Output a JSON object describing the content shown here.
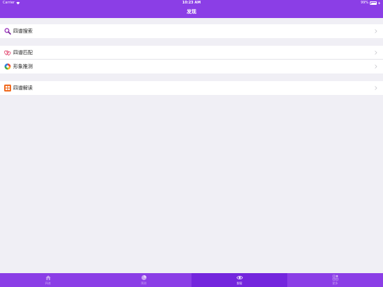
{
  "statusbar": {
    "carrier": "Carrier",
    "time": "10:23 AM",
    "battery": "99%"
  },
  "nav": {
    "title": "发现"
  },
  "groups": [
    {
      "items": [
        {
          "label": "四谱搜索",
          "icon": "search-icon"
        }
      ]
    },
    {
      "items": [
        {
          "label": "四谱匹配",
          "icon": "hearts-icon"
        },
        {
          "label": "形象推测",
          "icon": "color-wheel-icon"
        }
      ]
    },
    {
      "items": [
        {
          "label": "四谱解读",
          "icon": "grid-icon"
        }
      ]
    }
  ],
  "tabbar": {
    "tabs": [
      {
        "label": "四谱",
        "icon": "home-icon",
        "active": false
      },
      {
        "label": "预测",
        "icon": "pie-icon",
        "active": false
      },
      {
        "label": "发现",
        "icon": "eye-icon",
        "active": true
      },
      {
        "label": "更多",
        "icon": "apps-icon",
        "active": false
      }
    ]
  },
  "colors": {
    "accent": "#8b3ee6",
    "accent_active": "#7426dd",
    "background": "#f0eff5"
  }
}
